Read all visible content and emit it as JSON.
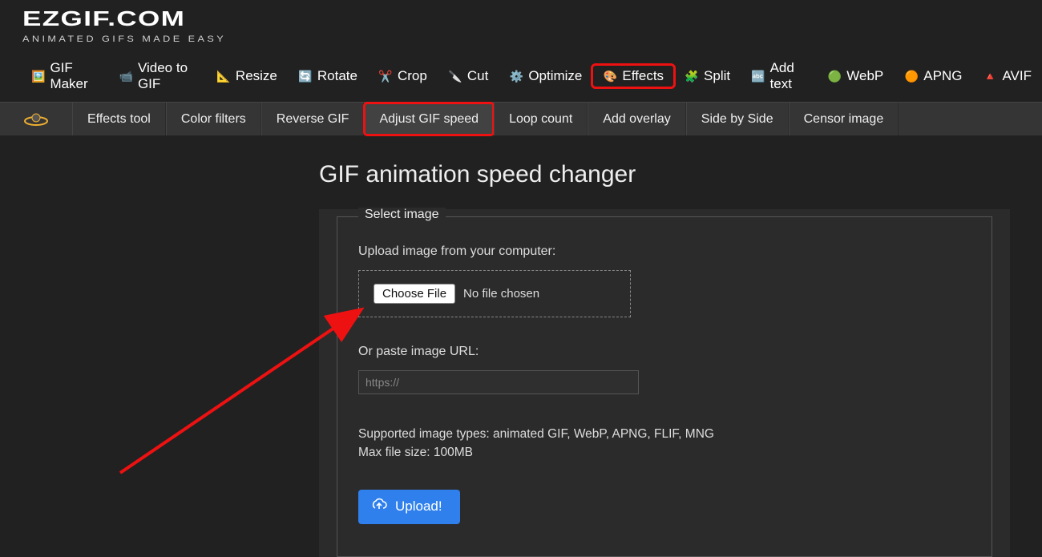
{
  "brand": {
    "title": "EZGIF.COM",
    "subtitle": "ANIMATED GIFS MADE EASY"
  },
  "nav_primary": [
    {
      "label": "GIF Maker",
      "icon": "gifmaker-icon",
      "highlight": false
    },
    {
      "label": "Video to GIF",
      "icon": "video-icon",
      "highlight": false
    },
    {
      "label": "Resize",
      "icon": "resize-icon",
      "highlight": false
    },
    {
      "label": "Rotate",
      "icon": "rotate-icon",
      "highlight": false
    },
    {
      "label": "Crop",
      "icon": "crop-icon",
      "highlight": false
    },
    {
      "label": "Cut",
      "icon": "cut-icon",
      "highlight": false
    },
    {
      "label": "Optimize",
      "icon": "optimize-icon",
      "highlight": false
    },
    {
      "label": "Effects",
      "icon": "effects-icon",
      "highlight": true
    },
    {
      "label": "Split",
      "icon": "split-icon",
      "highlight": false
    },
    {
      "label": "Add text",
      "icon": "addtext-icon",
      "highlight": false
    },
    {
      "label": "WebP",
      "icon": "webp-icon",
      "highlight": false
    },
    {
      "label": "APNG",
      "icon": "apng-icon",
      "highlight": false
    },
    {
      "label": "AVIF",
      "icon": "avif-icon",
      "highlight": false
    }
  ],
  "nav_secondary": [
    {
      "label": "Effects tool",
      "active": false,
      "highlight": false
    },
    {
      "label": "Color filters",
      "active": false,
      "highlight": false
    },
    {
      "label": "Reverse GIF",
      "active": false,
      "highlight": false
    },
    {
      "label": "Adjust GIF speed",
      "active": true,
      "highlight": true
    },
    {
      "label": "Loop count",
      "active": false,
      "highlight": false
    },
    {
      "label": "Add overlay",
      "active": false,
      "highlight": false
    },
    {
      "label": "Side by Side",
      "active": false,
      "highlight": false
    },
    {
      "label": "Censor image",
      "active": false,
      "highlight": false
    }
  ],
  "page": {
    "title": "GIF animation speed changer",
    "fieldset_legend": "Select image",
    "upload_label": "Upload image from your computer:",
    "choose_file_label": "Choose File",
    "file_status": "No file chosen",
    "url_label": "Or paste image URL:",
    "url_placeholder": "https://",
    "supported_line1": "Supported image types: animated GIF, WebP, APNG, FLIF, MNG",
    "supported_line2": "Max file size: 100MB",
    "upload_button": "Upload!"
  },
  "icon_glyphs": {
    "gifmaker-icon": "🖼️",
    "video-icon": "📹",
    "resize-icon": "📐",
    "rotate-icon": "🔄",
    "crop-icon": "✂️",
    "cut-icon": "🔪",
    "optimize-icon": "⚙️",
    "effects-icon": "🎨",
    "split-icon": "🧩",
    "addtext-icon": "🔤",
    "webp-icon": "🟢",
    "apng-icon": "🟠",
    "avif-icon": "🔺",
    "wand-icon": "🪄",
    "cloud-upload-icon": "☁"
  }
}
